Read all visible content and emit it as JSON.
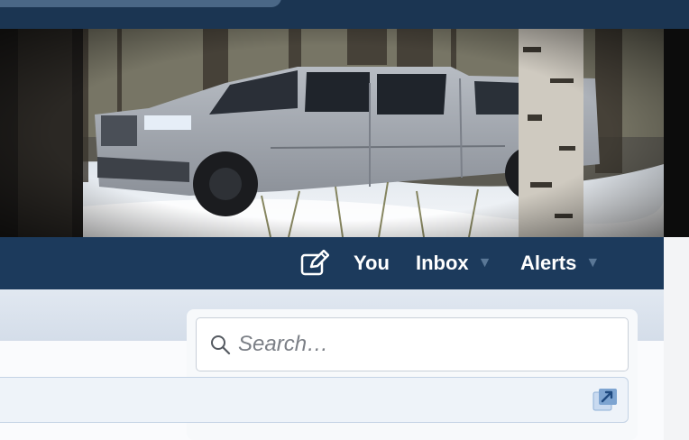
{
  "header": {
    "banner_alt": "Silver pickup truck parked in snowy woods"
  },
  "nav": {
    "compose_icon": "pencil-square-icon",
    "you_label": "You",
    "inbox_label": "Inbox",
    "alerts_label": "Alerts",
    "caret_glyph": "▼"
  },
  "search": {
    "placeholder": "Search…",
    "icon": "search-icon"
  },
  "content": {
    "popout_icon": "external-link-icon"
  },
  "colors": {
    "topbar": "#1b3552",
    "navbar": "#1c3a5c",
    "subbar": "#d4dde9",
    "accent_caret": "#5a7796",
    "link_row_border": "#c4d3e5"
  }
}
